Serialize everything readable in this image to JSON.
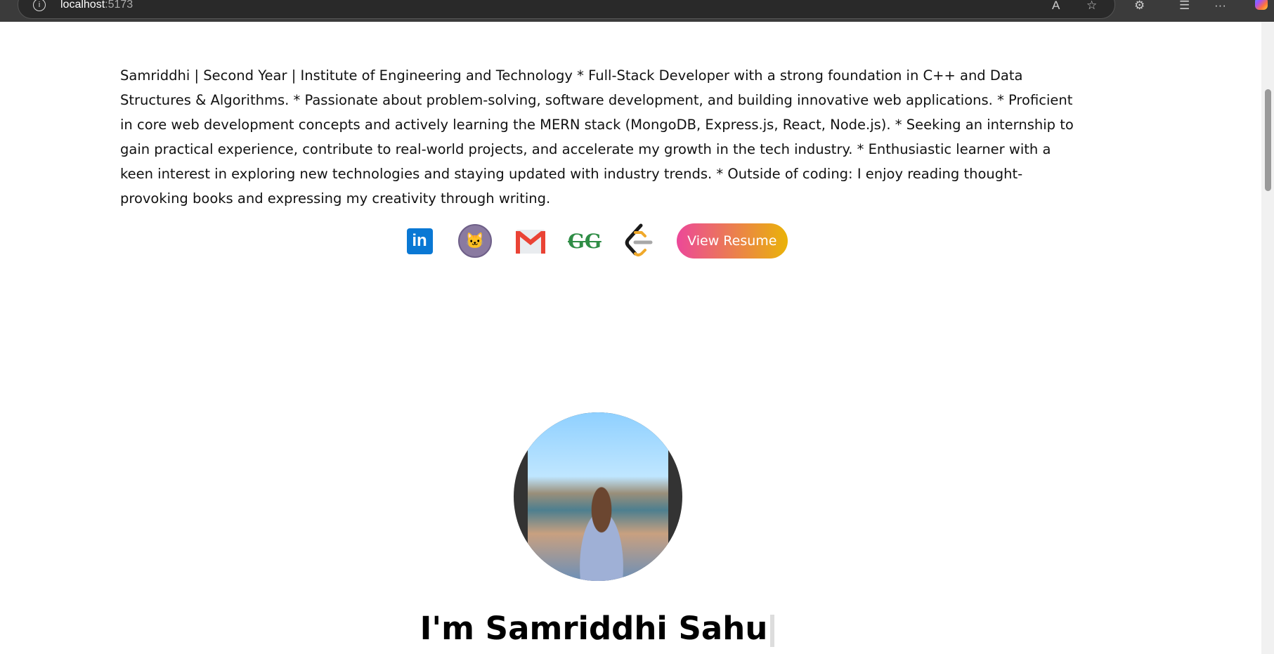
{
  "browser": {
    "host": "localhost",
    "port": ":5173"
  },
  "bio": "Samriddhi | Second Year | Institute of Engineering and Technology * Full-Stack Developer with a strong foundation in C++ and Data Structures & Algorithms. * Passionate about problem-solving, software development, and building innovative web applications. * Proficient in core web development concepts and actively learning the MERN stack (MongoDB, Express.js, React, Node.js). * Seeking an internship to gain practical experience, contribute to real-world projects, and accelerate my growth in the tech industry. * Enthusiastic learner with a keen interest in exploring new technologies and staying updated with industry trends. * Outside of coding: I enjoy reading thought-provoking books and expressing my creativity through writing.",
  "socials": {
    "linkedin": "in",
    "geeksforgeeks": "GG",
    "resume_label": "View Resume"
  },
  "hero": {
    "heading": "I'm Samriddhi Sahu"
  }
}
